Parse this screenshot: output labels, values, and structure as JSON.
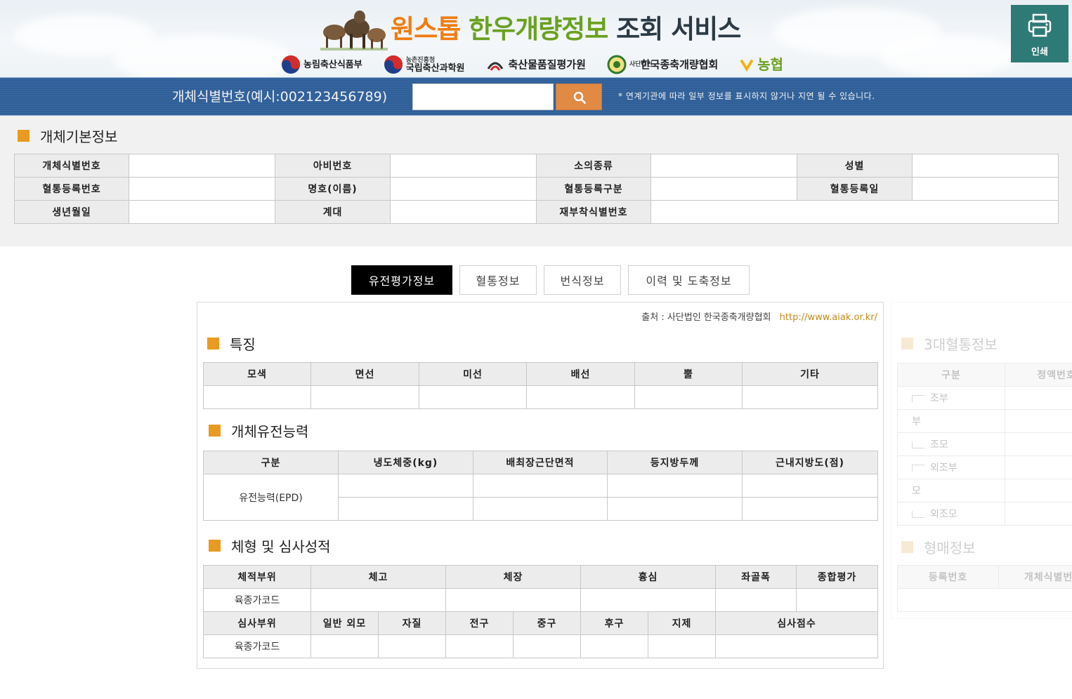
{
  "header": {
    "title_part1": "원스톱",
    "title_part2": "한우개량정보",
    "title_part3": "조회 서비스",
    "logos": [
      {
        "name": "농림축산식품부",
        "small": ""
      },
      {
        "name": "국립축산과학원",
        "small": "농촌진흥청"
      },
      {
        "name": "축산물품질평가원",
        "small": ""
      },
      {
        "name": "한국종축개량협회",
        "small": "사단법인"
      },
      {
        "name": "농협",
        "small": ""
      }
    ],
    "print_label": "인쇄"
  },
  "search": {
    "label": "개체식별번호(예시:002123456789)",
    "value": "",
    "note": "* 연계기관에 따라 일부 정보를 표시하지 않거나 지연 될 수 있습니다."
  },
  "basic_info": {
    "title": "개체기본정보",
    "labels": {
      "id_no": "개체식별번호",
      "father_no": "아비번호",
      "breed": "소의종류",
      "sex": "성별",
      "pedigree_no": "혈통등록번호",
      "name": "명호(이름)",
      "pedigree_class": "혈통등록구분",
      "pedigree_date": "혈통등록일",
      "birth_date": "생년월일",
      "generation": "계대",
      "reattach_no": "재부착식별번호"
    }
  },
  "tabs": [
    {
      "label": "유전평가정보",
      "active": true
    },
    {
      "label": "혈통정보",
      "active": false
    },
    {
      "label": "번식정보",
      "active": false
    },
    {
      "label": "이력 및 도축정보",
      "active": false
    }
  ],
  "genetic": {
    "source_label": "출처 : 사단법인 한국종축개량협회",
    "source_url": "http://www.aiak.or.kr/",
    "traits": {
      "title": "특징",
      "headers": [
        "모색",
        "면선",
        "미선",
        "배선",
        "뿔",
        "기타"
      ]
    },
    "ability": {
      "title": "개체유전능력",
      "headers": [
        "구분",
        "냉도체중(kg)",
        "배최장근단면적",
        "등지방두께",
        "근내지방도(점)"
      ],
      "row_label": "유전능력(EPD)"
    },
    "body": {
      "title": "체형 및 심사성적",
      "headers1": [
        "체적부위",
        "체고",
        "체장",
        "흉심",
        "좌골폭",
        "종합평가"
      ],
      "row1_label": "육종가코드",
      "headers2": [
        "심사부위",
        "일반 외모",
        "자질",
        "전구",
        "중구",
        "후구",
        "지제",
        "심사점수"
      ],
      "row2_label": "육종가코드"
    }
  },
  "side": {
    "pedigree_title": "3대혈통정보",
    "pedigree_headers": [
      "구분",
      "정액번호"
    ],
    "pedigree_rows": [
      "조부",
      "부",
      "조모",
      "외조부",
      "모",
      "외조모"
    ],
    "sibling_title": "형매정보",
    "sibling_headers": [
      "등록번호",
      "개체식별번호"
    ]
  }
}
